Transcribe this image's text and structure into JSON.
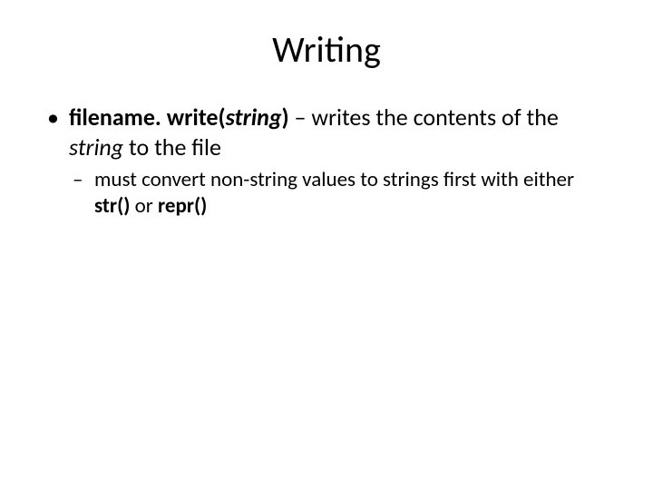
{
  "title": "Writing",
  "bullet1": {
    "pre": "filename. write(",
    "arg": "string",
    "close": ")",
    "dash": " – ",
    "rest1": "writes the contents of the ",
    "rest_string": "string",
    "rest2": " to the file"
  },
  "sub1": {
    "t1": "must convert non-string values to strings first with either ",
    "str": "str()",
    "or": " or ",
    "repr": "repr()"
  }
}
